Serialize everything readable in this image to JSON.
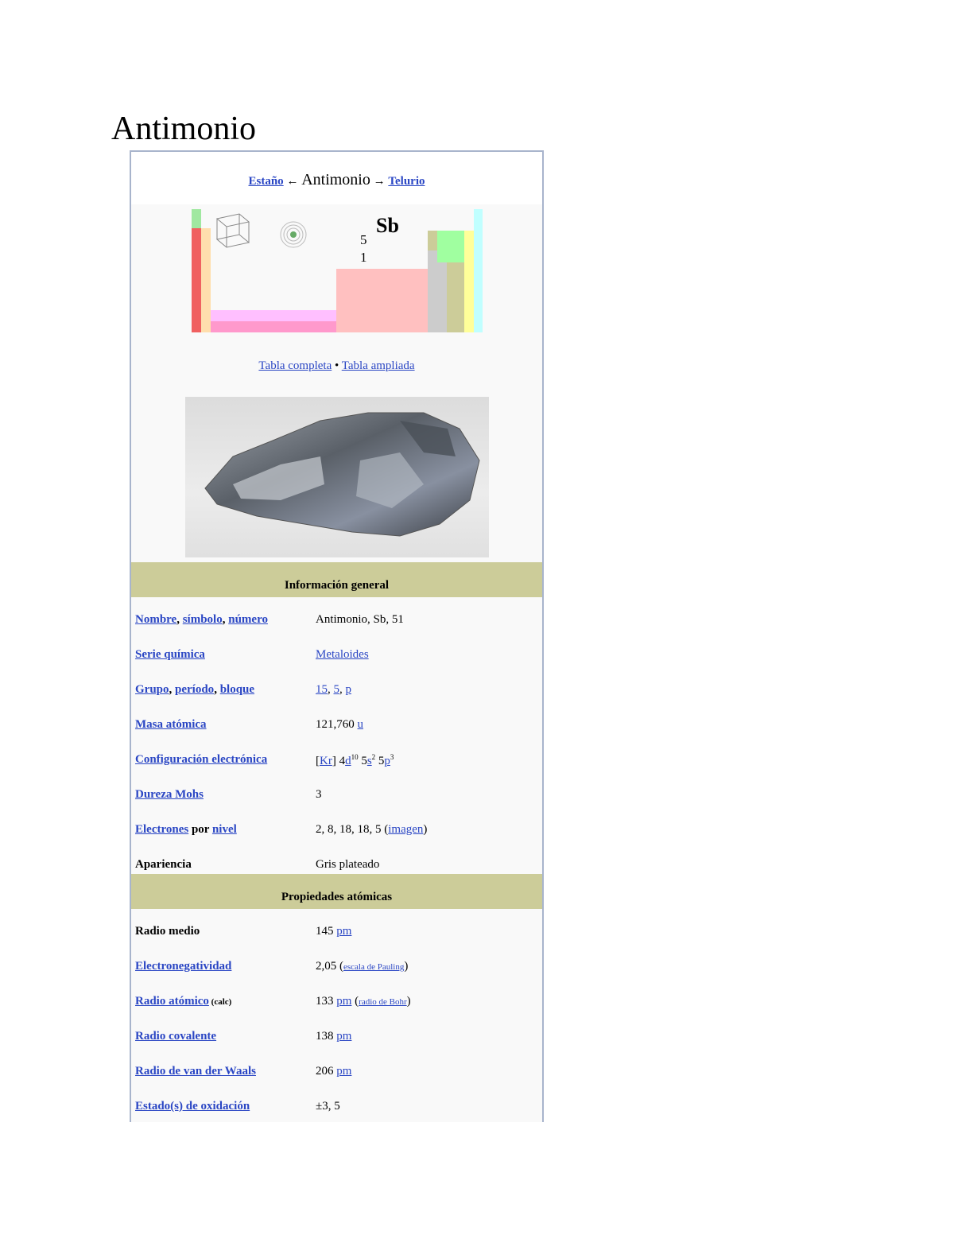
{
  "title": "Antimonio",
  "nav": {
    "prev": "Estaño",
    "arrow_left": "←",
    "current": "Antimonio",
    "arrow_right": "→",
    "next": "Telurio"
  },
  "periodic": {
    "symbol": "Sb",
    "number_line1": "5",
    "number_line2": "1"
  },
  "table_links": {
    "full": "Tabla completa",
    "sep": "•",
    "extended": "Tabla ampliada"
  },
  "sections": {
    "general": "Información general",
    "atomic": "Propiedades atómicas"
  },
  "general_rows": {
    "name": {
      "k1": "Nombre",
      "k2": "símbolo",
      "k3": "número",
      "sep": ", ",
      "value": "Antimonio, Sb, 51"
    },
    "series": {
      "key": "Serie química",
      "value": "Metaloides"
    },
    "group": {
      "k1": "Grupo",
      "k2": "período",
      "k3": "bloque",
      "sep": ", ",
      "v1": "15",
      "v2": "5",
      "v3": "p"
    },
    "mass": {
      "key": "Masa atómica",
      "value": "121,760",
      "unit": "u"
    },
    "config": {
      "key": "Configuración electrónica",
      "open": "[",
      "kr": "Kr",
      "close": "] 4",
      "d": "d",
      "d_sup": "10",
      "five1": " 5",
      "s": "s",
      "s_sup": "2",
      "five2": " 5",
      "p": "p",
      "p_sup": "3"
    },
    "mohs": {
      "key": "Dureza Mohs",
      "value": "3"
    },
    "electrons": {
      "k1": "Electrones",
      "k_mid": " por ",
      "k2": "nivel",
      "value": "2, 8, 18, 18, 5 (",
      "link": "imagen",
      "close": ")"
    },
    "appearance": {
      "key": "Apariencia",
      "value": "Gris plateado"
    }
  },
  "atomic_rows": {
    "mean_radius": {
      "key": "Radio medio",
      "value": "145",
      "unit": "pm"
    },
    "electroneg": {
      "key": "Electronegatividad",
      "value": "2,05 (",
      "scale": "escala de Pauling",
      "close": ")"
    },
    "atomic_radius": {
      "key": "Radio atómico",
      "calc": " (calc)",
      "value": "133",
      "unit": "pm",
      "open": " (",
      "bohr": "radio de Bohr",
      "close": ")"
    },
    "covalent": {
      "key": "Radio covalente",
      "value": "138",
      "unit": "pm"
    },
    "vdw": {
      "key": "Radio de van der Waals",
      "value": "206",
      "unit": "pm"
    },
    "oxidation": {
      "key": "Estado(s) de oxidación",
      "value": "±3, 5"
    }
  },
  "colors": {
    "link": "#2a46c4",
    "section_bg": "#cccc99",
    "border": "#a8b4cc"
  }
}
